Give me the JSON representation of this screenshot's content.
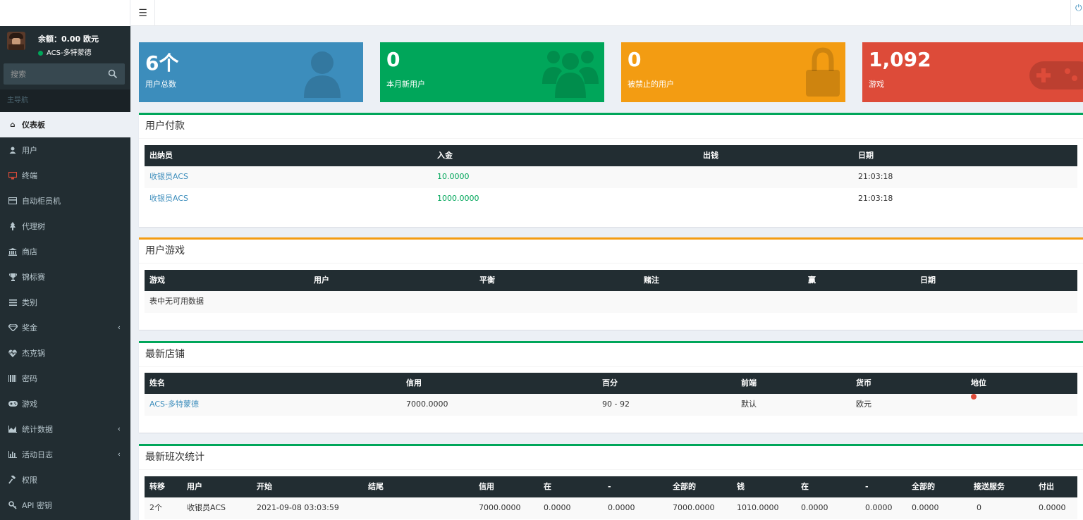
{
  "sidebar": {
    "balance": "余额：0.00 欧元",
    "user_name": "ACS-多特蒙德",
    "search_placeholder": "搜索",
    "nav_header": "主导航",
    "items": [
      {
        "label": "仪表板",
        "icon": "home-icon"
      },
      {
        "label": "用户",
        "icon": "user-icon"
      },
      {
        "label": "终端",
        "icon": "monitor-icon"
      },
      {
        "label": "自动柜员机",
        "icon": "credit-card-icon"
      },
      {
        "label": "代理树",
        "icon": "tree-icon"
      },
      {
        "label": "商店",
        "icon": "bank-icon"
      },
      {
        "label": "锦标赛",
        "icon": "trophy-icon"
      },
      {
        "label": "类别",
        "icon": "list-icon"
      },
      {
        "label": "奖金",
        "icon": "diamond-icon"
      },
      {
        "label": "杰克锅",
        "icon": "heartbeat-icon"
      },
      {
        "label": "密码",
        "icon": "barcode-icon"
      },
      {
        "label": "游戏",
        "icon": "gamepad-icon"
      },
      {
        "label": "统计数据",
        "icon": "area-chart-icon"
      },
      {
        "label": "活动日志",
        "icon": "bar-chart-icon"
      },
      {
        "label": "权限",
        "icon": "gavel-icon"
      },
      {
        "label": "API 密钥",
        "icon": "key-icon"
      }
    ]
  },
  "stats": [
    {
      "value": "6个",
      "label": "用户总数",
      "icon": "user-icon",
      "color": "#3c8dbc"
    },
    {
      "value": "0",
      "label": "本月新用户",
      "icon": "users-icon",
      "color": "#00a65a"
    },
    {
      "value": "0",
      "label": "被禁止的用户",
      "icon": "lock-icon",
      "color": "#f39c12"
    },
    {
      "value": "1,092",
      "label": "游戏",
      "icon": "gamepad-icon",
      "color": "#dd4b39"
    }
  ],
  "payments": {
    "title": "用户付款",
    "headers": [
      "出纳员",
      "入金",
      "出钱",
      "日期"
    ],
    "rows": [
      [
        "收银员ACS",
        "10.0000",
        "",
        "21:03:18"
      ],
      [
        "收银员ACS",
        "1000.0000",
        "",
        "21:03:18"
      ]
    ]
  },
  "user_games": {
    "title": "用户游戏",
    "headers": [
      "游戏",
      "用户",
      "平衡",
      "赌注",
      "赢",
      "日期"
    ],
    "empty": "表中无可用数据"
  },
  "shops": {
    "title": "最新店铺",
    "headers": [
      "姓名",
      "信用",
      "百分",
      "前端",
      "货币",
      "地位"
    ],
    "rows": [
      [
        "ACS-多特蒙德",
        "7000.0000",
        "90 - 92",
        "默认",
        "欧元",
        ""
      ]
    ]
  },
  "shifts": {
    "title": "最新班次统计",
    "headers": [
      "转移",
      "用户",
      "开始",
      "结尾",
      "信用",
      "在",
      "-",
      "全部的",
      "钱",
      "在",
      "-",
      "全部的",
      "接送服务",
      "付出"
    ],
    "rows": [
      [
        "2个",
        "收银员ACS",
        "2021-09-08 03:03:59",
        "",
        "7000.0000",
        "0.0000",
        "0.0000",
        "7000.0000",
        "1010.0000",
        "0.0000",
        "0.0000",
        "0.0000",
        "0",
        "0.0000"
      ]
    ]
  }
}
